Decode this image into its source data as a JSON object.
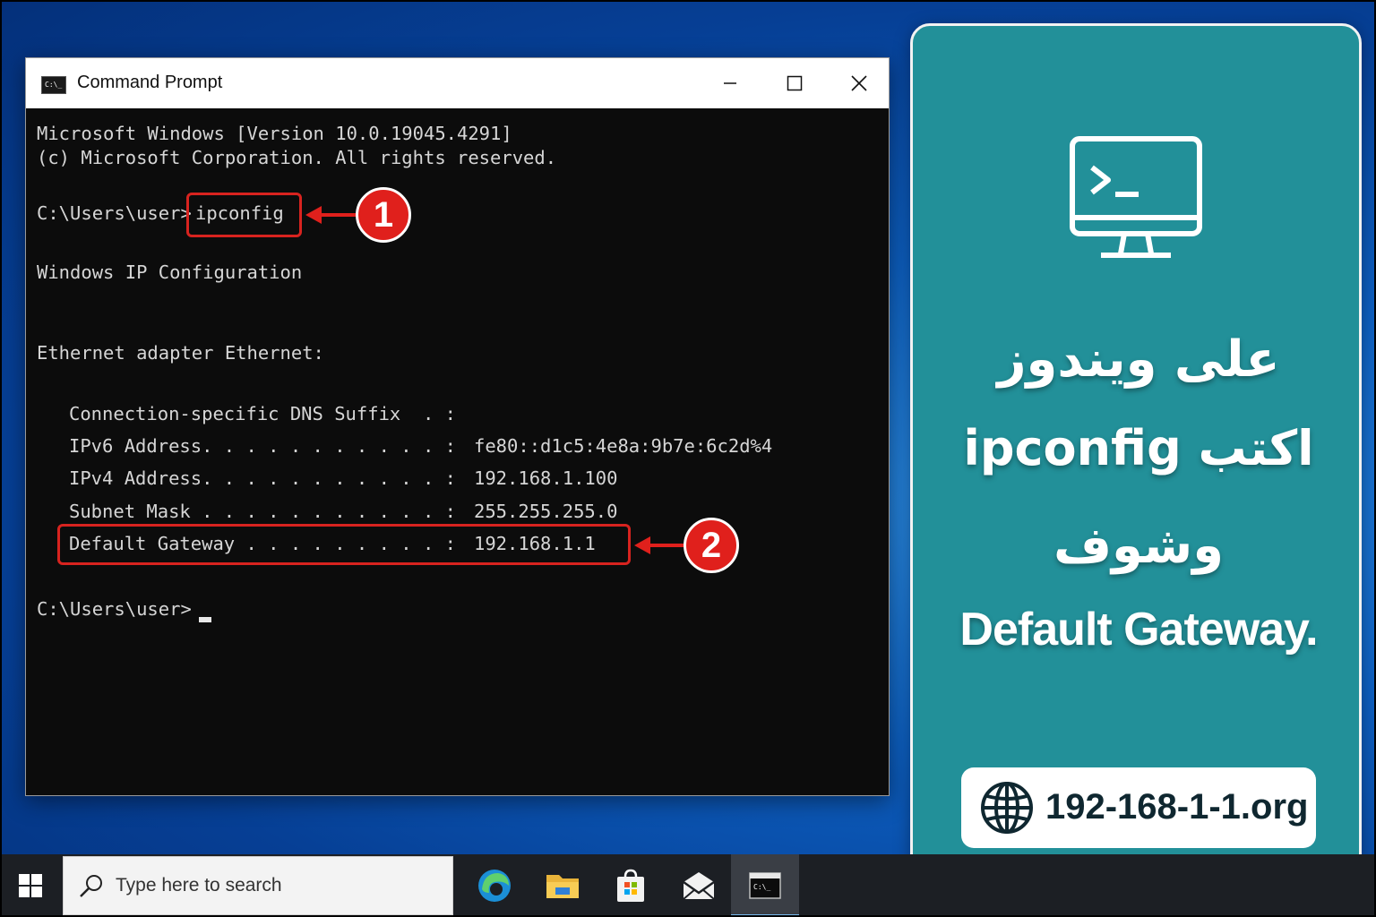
{
  "window": {
    "title": "Command Prompt",
    "icon_text": "C:\\_",
    "icon": "cmd-icon",
    "controls": {
      "minimize_icon": "minimize-icon",
      "maximize_icon": "maximize-icon",
      "close_icon": "close-icon"
    }
  },
  "console": {
    "header1": "Microsoft Windows [Version 10.0.19045.4291]",
    "header2": "(c) Microsoft Corporation. All rights reserved.",
    "prompt1": "C:\\Users\\user>",
    "command": "ipconfig",
    "section_title": "Windows IP Configuration",
    "adapter": "Ethernet adapter Ethernet:",
    "rows": [
      {
        "label": "Connection-specific DNS Suffix  . :",
        "value": ""
      },
      {
        "label": "IPv6 Address. . . . . . . . . . . :",
        "value": "fe80::d1c5:4e8a:9b7e:6c2d%4"
      },
      {
        "label": "IPv4 Address. . . . . . . . . . . :",
        "value": "192.168.1.100"
      },
      {
        "label": "Subnet Mask . . . . . . . . . . . :",
        "value": "255.255.255.0"
      },
      {
        "label": "Default Gateway . . . . . . . . . :",
        "value": "192.168.1.1"
      }
    ],
    "prompt2": "C:\\Users\\user>"
  },
  "annotations": {
    "step1": "1",
    "step2": "2",
    "color": "#e0201c"
  },
  "panel": {
    "icon": "terminal-monitor-icon",
    "line1": "على ويندوز",
    "line2": "اكتب ipconfig",
    "line3": "وشوف",
    "line4": "Default Gateway.",
    "url": "192-168-1-1.org",
    "url_icon": "globe-icon",
    "bg_color": "#229099"
  },
  "taskbar": {
    "search_placeholder": "Type here to search",
    "apps": [
      "edge-icon",
      "file-explorer-icon",
      "store-icon",
      "mail-icon",
      "cmd-icon"
    ]
  }
}
